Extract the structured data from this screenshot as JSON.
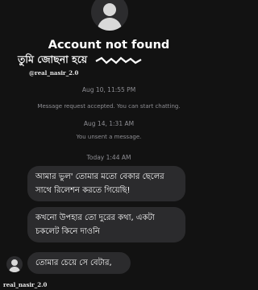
{
  "header": {
    "title": "Account not found",
    "overlay_text": "তুমি জোছনা হয়ে",
    "watermark": "@real_nasir_2.0"
  },
  "messages": {
    "timestamp_1": "Aug 10, 11:55 PM",
    "accepted_notice": "Message request accepted. You can start chatting.",
    "timestamp_2": "Aug 14, 1:31 AM",
    "unsent_notice": "You unsent a message.",
    "timestamp_3": "Today 1:44 AM",
    "bubble_1": "আমার ভুল' তোমার মতো বেকার ছেলের সাথে রিলেশন করতে গিয়েছি!",
    "bubble_2": "কখনো উপহার তো দুরের কথা, একটা চকলেট কিনে দাওনি",
    "bubble_3": "তোমার চেয়ে সে বেটার,"
  },
  "footer": {
    "watermark": "real_nasir_2.0"
  }
}
